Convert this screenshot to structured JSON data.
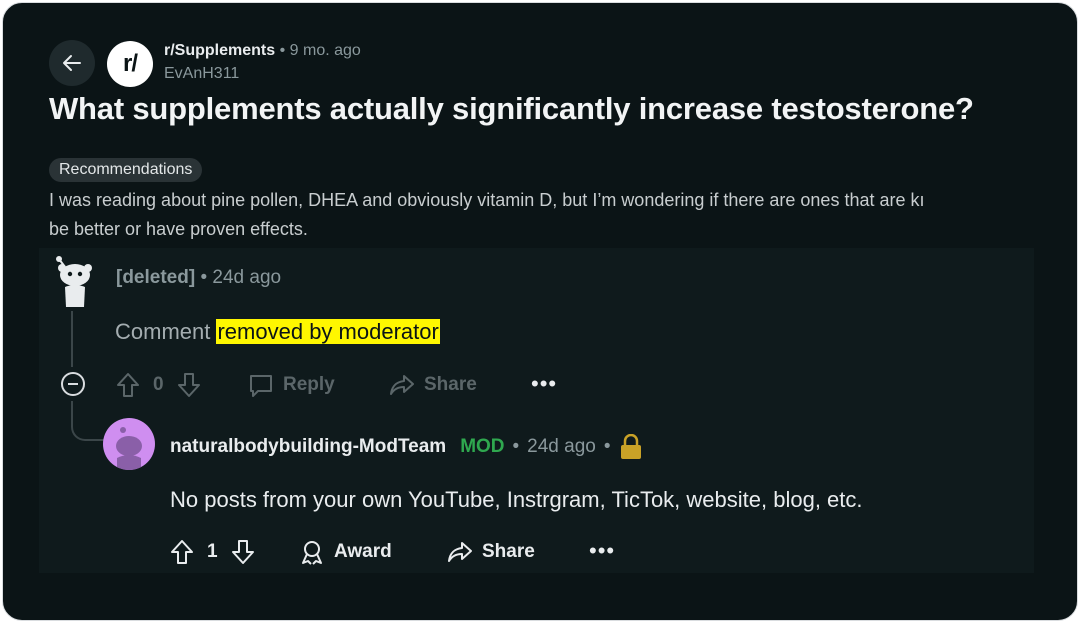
{
  "post": {
    "subreddit": "r/Supplements",
    "sub_avatar_text": "r/",
    "separator": "•",
    "age": "9 mo. ago",
    "author": "EvAnH311",
    "title": "What supplements actually significantly increase testosterone?",
    "flair": "Recommendations",
    "body_line1": "I was reading about pine pollen, DHEA and obviously vitamin D, but I’m wondering if there are ones that are kı",
    "body_line2": "be better or have proven effects."
  },
  "comment1": {
    "author": "[deleted]",
    "separator": "•",
    "age": "24d ago",
    "body_prefix": "Comment",
    "body_highlight": "removed by moderator",
    "votes": "0",
    "reply_label": "Reply",
    "share_label": "Share",
    "more": "•••"
  },
  "comment2": {
    "author": "naturalbodybuilding-ModTeam",
    "badge": "MOD",
    "separator": "•",
    "age": "24d ago",
    "separator2": "•",
    "body": "No posts from your own YouTube, Instrgram, TicTok, website, blog, etc.",
    "votes": "1",
    "award_label": "Award",
    "share_label": "Share",
    "more": "•••"
  },
  "icons": [
    "back-arrow-icon",
    "snoo-avatar-icon",
    "collapse-icon",
    "upvote-icon",
    "downvote-icon",
    "comment-icon",
    "share-icon",
    "award-icon",
    "lock-icon",
    "more-icon"
  ],
  "colors": {
    "background": "#0b1416",
    "mod_green": "#2fa84f",
    "highlight": "#fff700",
    "lock": "#c9a227"
  }
}
